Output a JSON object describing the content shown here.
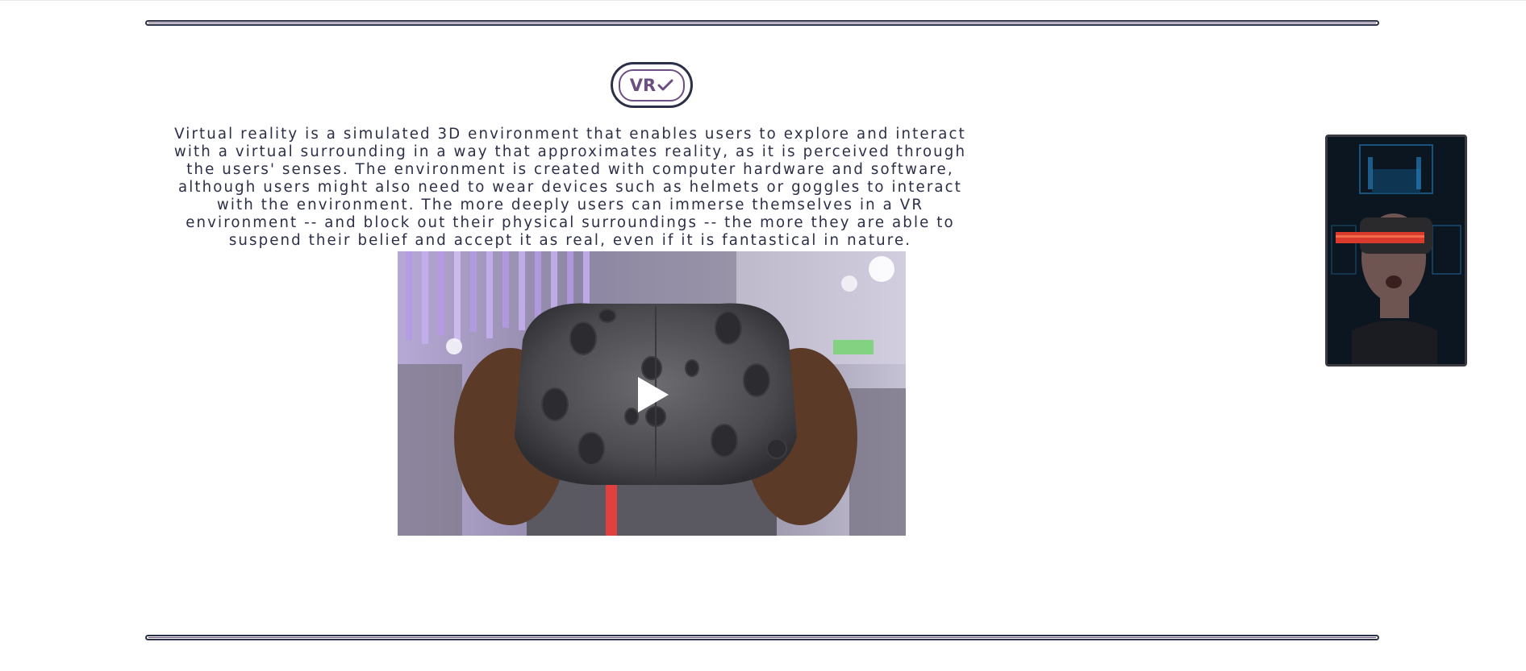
{
  "logo": {
    "text": "VR",
    "icon": "check-icon"
  },
  "intro": {
    "text": "Virtual reality is a simulated 3D environment that enables users to explore and interact with a virtual surrounding in a way that approximates reality, as it is perceived through the users' senses. The environment is created with computer hardware and software, although users might also need to wear devices such as helmets or goggles to interact with the environment. The more deeply users can immerse themselves in a VR environment -- and block out their physical surroundings -- the more they are able to suspend their belief and accept it as real, even if it is fantastical in nature."
  },
  "video": {
    "thumbnail": "vr-headset-thumbnail",
    "play_icon": "play-icon"
  },
  "side_image": {
    "subject": "person-wearing-vr-headset"
  },
  "colors": {
    "primary": "#2c2f48",
    "accent": "#6b4f82",
    "background": "#ffffff"
  }
}
